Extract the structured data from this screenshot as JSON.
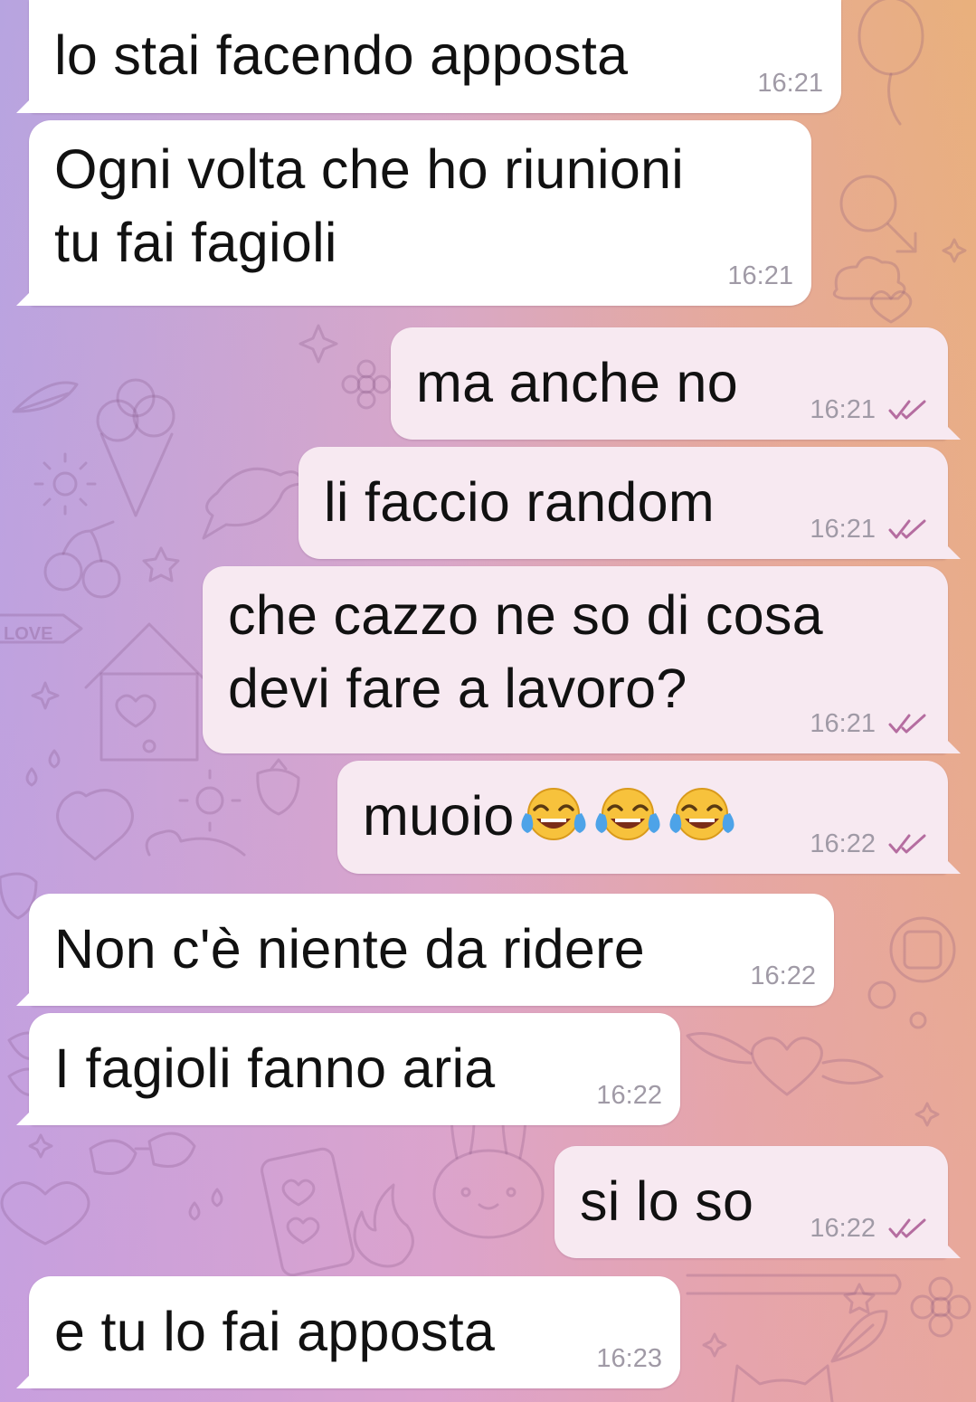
{
  "chat": {
    "messages": [
      {
        "direction": "in",
        "text": "lo stai facendo apposta",
        "time": "16:21"
      },
      {
        "direction": "in",
        "text": "Ogni volta che ho riunioni\ntu fai fagioli",
        "time": "16:21"
      },
      {
        "direction": "out",
        "text": "ma anche no",
        "time": "16:21",
        "status": "read"
      },
      {
        "direction": "out",
        "text": "li faccio random",
        "time": "16:21",
        "status": "read"
      },
      {
        "direction": "out",
        "text": "che cazzo ne so di cosa\ndevi fare a lavoro?",
        "time": "16:21",
        "status": "read"
      },
      {
        "direction": "out",
        "text": "muoio",
        "emoji": [
          "face-with-tears-of-joy",
          "face-with-tears-of-joy",
          "face-with-tears-of-joy"
        ],
        "time": "16:22",
        "status": "read"
      },
      {
        "direction": "in",
        "text": "Non c'è niente da ridere",
        "time": "16:22"
      },
      {
        "direction": "in",
        "text": "I fagioli fanno aria",
        "time": "16:22"
      },
      {
        "direction": "out",
        "text": "si lo so",
        "time": "16:22",
        "status": "read"
      },
      {
        "direction": "in",
        "text": "e tu lo fai apposta",
        "time": "16:23"
      }
    ]
  },
  "background": {
    "doodle_label": "LOVE",
    "gradient_colors": [
      "#b7a4e0",
      "#d7a9c6",
      "#e6ab95",
      "#e9b07c"
    ]
  },
  "colors": {
    "incoming_bubble": "#ffffff",
    "outgoing_bubble": "#f7e9f1",
    "timestamp": "#a09aa6",
    "read_check": "#b56da0"
  }
}
